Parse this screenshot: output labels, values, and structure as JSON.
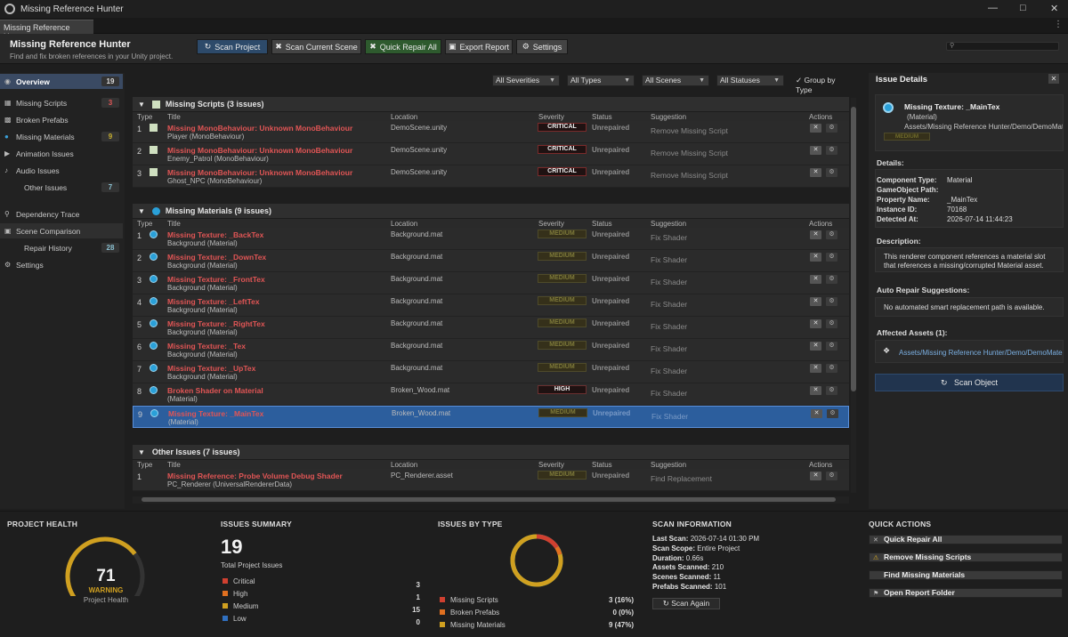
{
  "window": {
    "title": "Missing Reference Hunter",
    "tab": "Missing Reference Hunter"
  },
  "header": {
    "title": "Missing Reference Hunter",
    "subtitle": "Find and fix broken references in your Unity project.",
    "buttons": [
      {
        "label": "Scan Project",
        "icon": "refresh-icon",
        "color": "#2d4a6a"
      },
      {
        "label": "Scan Current Scene",
        "icon": "wrench-icon",
        "color": "#444444"
      },
      {
        "label": "Quick Repair All",
        "icon": "wrench-icon",
        "color": "#2e5a2e"
      },
      {
        "label": "Export Report",
        "icon": "save-icon",
        "color": "#444444"
      },
      {
        "label": "Settings",
        "icon": "gear-icon",
        "color": "#444444"
      }
    ],
    "search_placeholder": ""
  },
  "sidebar": {
    "items": [
      {
        "label": "Overview",
        "count": "19",
        "active": true,
        "icon": "overview-icon"
      },
      {
        "label": "Missing Scripts",
        "count": "3",
        "icon": "script-icon",
        "count_color": "#e05555"
      },
      {
        "label": "Broken Prefabs",
        "count": "",
        "icon": "prefab-icon"
      },
      {
        "label": "Missing Materials",
        "count": "9",
        "icon": "material-icon",
        "count_color": "#c8b030"
      },
      {
        "label": "Animation Issues",
        "count": "",
        "icon": "animation-icon"
      },
      {
        "label": "Audio Issues",
        "count": "",
        "icon": "audio-icon"
      },
      {
        "label": "Other Issues",
        "count": "7",
        "icon": "",
        "count_color": "#8ac0d0"
      },
      {
        "label": "Dependency Trace",
        "count": "",
        "icon": "dependency-icon"
      },
      {
        "label": "Scene Comparison",
        "count": "",
        "icon": "scene-icon",
        "highlight": true
      },
      {
        "label": "Repair History",
        "count": "28",
        "icon": "",
        "count_color": "#8ac0d0"
      },
      {
        "label": "Settings",
        "count": "",
        "icon": "gear-icon"
      }
    ]
  },
  "filters": [
    {
      "label": "All Severities"
    },
    {
      "label": "All Types"
    },
    {
      "label": "All Scenes"
    },
    {
      "label": "All Statuses"
    }
  ],
  "group_by_type": "Group by Type",
  "columns": {
    "type": "Type",
    "title": "Title",
    "location": "Location",
    "severity": "Severity",
    "status": "Status",
    "suggestion": "Suggestion",
    "actions": "Actions"
  },
  "sections": [
    {
      "title": "Missing Scripts (3 issues)",
      "rows": [
        {
          "n": "1",
          "title": "Missing MonoBehaviour: Unknown MonoBehaviour",
          "sub": "Player (MonoBehaviour)",
          "loc": "DemoScene.unity",
          "sev": "CRITICAL",
          "sevc": "crit",
          "status": "Unrepaired",
          "sug": "Remove Missing Script"
        },
        {
          "n": "2",
          "title": "Missing MonoBehaviour: Unknown MonoBehaviour",
          "sub": "Enemy_Patrol (MonoBehaviour)",
          "loc": "DemoScene.unity",
          "sev": "CRITICAL",
          "sevc": "crit",
          "status": "Unrepaired",
          "sug": "Remove Missing Script"
        },
        {
          "n": "3",
          "title": "Missing MonoBehaviour: Unknown MonoBehaviour",
          "sub": "Ghost_NPC (MonoBehaviour)",
          "loc": "DemoScene.unity",
          "sev": "CRITICAL",
          "sevc": "crit",
          "status": "Unrepaired",
          "sug": "Remove Missing Script"
        }
      ]
    },
    {
      "title": "Missing Materials (9 issues)",
      "rows": [
        {
          "n": "1",
          "title": "Missing Texture: _BackTex",
          "sub": "Background (Material)",
          "loc": "Background.mat",
          "sev": "MEDIUM",
          "sevc": "med",
          "status": "Unrepaired",
          "sug": "Fix Shader"
        },
        {
          "n": "2",
          "title": "Missing Texture: _DownTex",
          "sub": "Background (Material)",
          "loc": "Background.mat",
          "sev": "MEDIUM",
          "sevc": "med",
          "status": "Unrepaired",
          "sug": "Fix Shader"
        },
        {
          "n": "3",
          "title": "Missing Texture: _FrontTex",
          "sub": "Background (Material)",
          "loc": "Background.mat",
          "sev": "MEDIUM",
          "sevc": "med",
          "status": "Unrepaired",
          "sug": "Fix Shader"
        },
        {
          "n": "4",
          "title": "Missing Texture: _LeftTex",
          "sub": "Background (Material)",
          "loc": "Background.mat",
          "sev": "MEDIUM",
          "sevc": "med",
          "status": "Unrepaired",
          "sug": "Fix Shader"
        },
        {
          "n": "5",
          "title": "Missing Texture: _RightTex",
          "sub": "Background (Material)",
          "loc": "Background.mat",
          "sev": "MEDIUM",
          "sevc": "med",
          "status": "Unrepaired",
          "sug": "Fix Shader"
        },
        {
          "n": "6",
          "title": "Missing Texture: _Tex",
          "sub": "Background (Material)",
          "loc": "Background.mat",
          "sev": "MEDIUM",
          "sevc": "med",
          "status": "Unrepaired",
          "sug": "Fix Shader"
        },
        {
          "n": "7",
          "title": "Missing Texture: _UpTex",
          "sub": "Background (Material)",
          "loc": "Background.mat",
          "sev": "MEDIUM",
          "sevc": "med",
          "status": "Unrepaired",
          "sug": "Fix Shader"
        },
        {
          "n": "8",
          "title": "Broken Shader on Material",
          "sub": "(Material)",
          "loc": "Broken_Wood.mat",
          "sev": "HIGH",
          "sevc": "high",
          "status": "Unrepaired",
          "sug": "Fix Shader"
        },
        {
          "n": "9",
          "title": "Missing Texture: _MainTex",
          "sub": "(Material)",
          "loc": "Broken_Wood.mat",
          "sev": "MEDIUM",
          "sevc": "med",
          "status": "Unrepaired",
          "sug": "Fix Shader",
          "selected": true
        }
      ]
    },
    {
      "title": "Other Issues (7 issues)",
      "rows": [
        {
          "n": "1",
          "title": "Missing Reference: Probe Volume Debug Shader",
          "sub": "PC_Renderer (UniversalRendererData)",
          "loc": "PC_Renderer.asset",
          "sev": "MEDIUM",
          "sevc": "med",
          "status": "Unrepaired",
          "sug": "Find Replacement"
        }
      ]
    }
  ],
  "details": {
    "header": "Issue Details",
    "title": "Missing Texture: _MainTex",
    "type": "(Material)",
    "path": "Assets/Missing Reference Hunter/Demo/DemoMat",
    "badge": "MEDIUM",
    "details_label": "Details:",
    "kv": [
      {
        "k": "Component Type:",
        "v": "Material"
      },
      {
        "k": "GameObject Path:",
        "v": ""
      },
      {
        "k": "Property Name:",
        "v": "_MainTex"
      },
      {
        "k": "Instance ID:",
        "v": "70168"
      },
      {
        "k": "Detected At:",
        "v": "2026-07-14 11:44:23"
      }
    ],
    "description_label": "Description:",
    "description": "This renderer component references a material slot that references a missing/corrupted Material asset.",
    "repair_label": "Auto Repair Suggestions:",
    "repair": "No automated smart replacement path is available.",
    "affected_label": "Affected Assets (1):",
    "affected": "Assets/Missing Reference Hunter/Demo/DemoMater",
    "scan_button": "Scan Object"
  },
  "health": {
    "title": "PROJECT HEALTH",
    "score": "71",
    "score_value": 71,
    "status": "WARNING",
    "label": "Project Health"
  },
  "summary": {
    "title": "ISSUES SUMMARY",
    "total": "19",
    "total_label": "Total Project Issues",
    "items": [
      {
        "label": "Critical",
        "value": "3",
        "color": "#d04030"
      },
      {
        "label": "High",
        "value": "1",
        "color": "#e07020"
      },
      {
        "label": "Medium",
        "value": "15",
        "color": "#d0a020"
      },
      {
        "label": "Low",
        "value": "0",
        "color": "#3070c0"
      }
    ]
  },
  "by_type": {
    "title": "ISSUES BY TYPE",
    "items": [
      {
        "label": "Missing Scripts",
        "value": "3 (16%)",
        "color": "#d04030"
      },
      {
        "label": "Broken Prefabs",
        "value": "0 (0%)",
        "color": "#e07020"
      },
      {
        "label": "Missing Materials",
        "value": "9 (47%)",
        "color": "#d0a020"
      }
    ]
  },
  "scan_info": {
    "title": "SCAN INFORMATION",
    "items": [
      {
        "k": "Last Scan:",
        "v": "2026-07-14 01:30 PM"
      },
      {
        "k": "Scan Scope:",
        "v": "Entire Project"
      },
      {
        "k": "Duration:",
        "v": "0.66s"
      },
      {
        "k": "Assets Scanned:",
        "v": "210"
      },
      {
        "k": "Scenes Scanned:",
        "v": "11"
      },
      {
        "k": "Prefabs Scanned:",
        "v": "101"
      }
    ],
    "button": "Scan Again"
  },
  "quick_actions": {
    "title": "QUICK ACTIONS",
    "items": [
      {
        "label": "Quick Repair All",
        "icon": "close-icon"
      },
      {
        "label": "Remove Missing Scripts",
        "icon": "warning-icon"
      },
      {
        "label": "Find Missing Materials",
        "icon": ""
      },
      {
        "label": "Open Report Folder",
        "icon": "folder-icon"
      }
    ]
  }
}
